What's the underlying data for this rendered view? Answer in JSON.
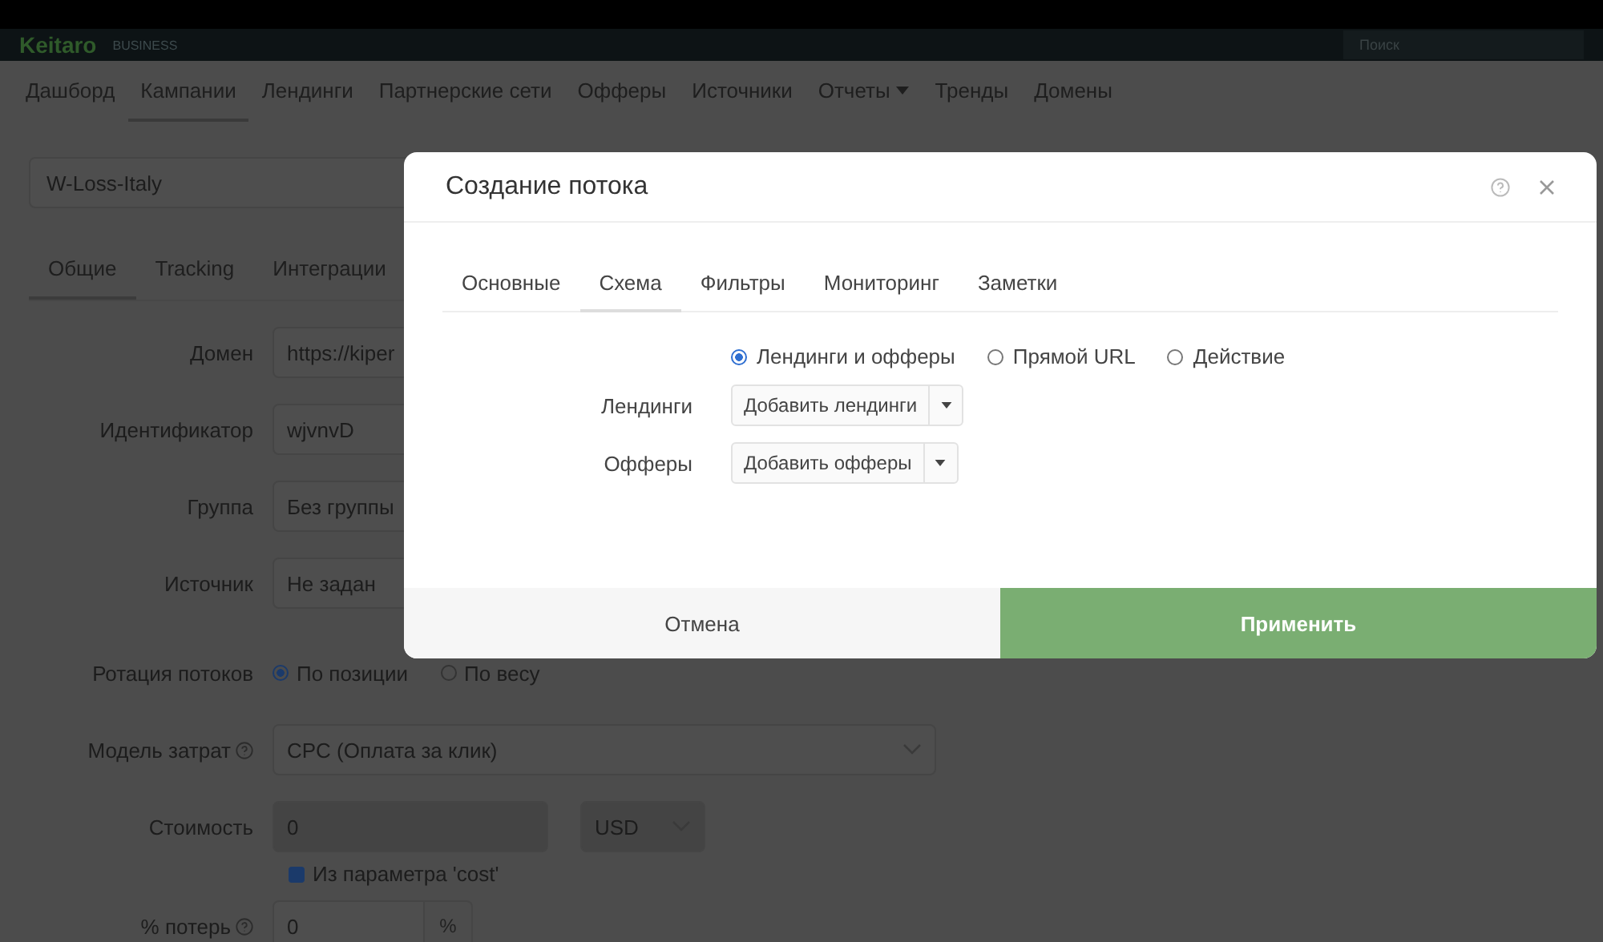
{
  "header": {
    "logo": "Keitaro",
    "edition": "BUSINESS",
    "search": {
      "placeholder": "Поиск"
    }
  },
  "nav": [
    {
      "label": "Дашборд",
      "selected": false,
      "has_menu": false
    },
    {
      "label": "Кампании",
      "selected": true,
      "has_menu": false
    },
    {
      "label": "Лендинги",
      "selected": false,
      "has_menu": false
    },
    {
      "label": "Партнерские сети",
      "selected": false,
      "has_menu": false
    },
    {
      "label": "Офферы",
      "selected": false,
      "has_menu": false
    },
    {
      "label": "Источники",
      "selected": false,
      "has_menu": false
    },
    {
      "label": "Отчеты",
      "selected": false,
      "has_menu": true
    },
    {
      "label": "Тренды",
      "selected": false,
      "has_menu": false
    },
    {
      "label": "Домены",
      "selected": false,
      "has_menu": false
    }
  ],
  "campaign": {
    "name": "W-Loss-Italy",
    "tabs": [
      {
        "label": "Общие",
        "selected": true
      },
      {
        "label": "Tracking",
        "selected": false
      },
      {
        "label": "Интеграции",
        "selected": false
      }
    ],
    "fields": [
      {
        "kind": "input",
        "label": "Домен",
        "help": false,
        "value": "https://kiper"
      },
      {
        "kind": "input",
        "label": "Идентификатор",
        "help": false,
        "value": "wjvnvD"
      },
      {
        "kind": "input",
        "label": "Группа",
        "help": false,
        "value": "Без группы"
      },
      {
        "kind": "input",
        "label": "Источник",
        "help": false,
        "value": "Не задан"
      },
      {
        "kind": "radio",
        "label": "Ротация потоков",
        "help": false,
        "options": [
          {
            "label": "По позиции",
            "selected": true
          },
          {
            "label": "По весу",
            "selected": false
          }
        ]
      },
      {
        "kind": "select",
        "label": "Модель затрат",
        "help": true,
        "value": "CPC (Оплата за клик)"
      },
      {
        "kind": "cost",
        "label": "Стоимость",
        "help": false,
        "value": "0",
        "currency": "USD",
        "checkbox": {
          "label": "Из параметра 'cost'",
          "checked": true
        }
      },
      {
        "kind": "percent",
        "label": "% потерь",
        "help": true,
        "value": "0",
        "unit": "%"
      }
    ]
  },
  "modal": {
    "title": "Создание потока",
    "tabs": [
      {
        "label": "Основные",
        "selected": false
      },
      {
        "label": "Схема",
        "selected": true
      },
      {
        "label": "Фильтры",
        "selected": false
      },
      {
        "label": "Мониторинг",
        "selected": false
      },
      {
        "label": "Заметки",
        "selected": false
      }
    ],
    "schema_options": [
      {
        "label": "Лендинги и офферы",
        "selected": true
      },
      {
        "label": "Прямой URL",
        "selected": false
      },
      {
        "label": "Действие",
        "selected": false
      }
    ],
    "rows": [
      {
        "label": "Лендинги",
        "button": "Добавить лендинги"
      },
      {
        "label": "Офферы",
        "button": "Добавить офферы"
      }
    ],
    "buttons": [
      {
        "kind": "cancel",
        "label": "Отмена"
      },
      {
        "kind": "primary",
        "label": "Применить"
      }
    ]
  }
}
